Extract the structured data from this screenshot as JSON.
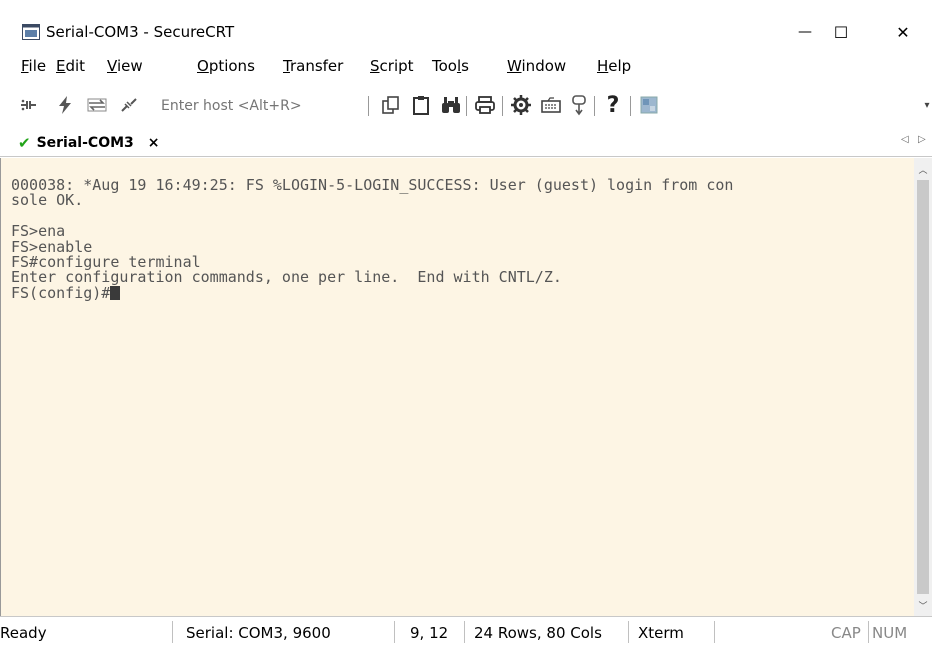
{
  "window": {
    "title": "Serial-COM3 - SecureCRT",
    "minimize_glyph": "—",
    "maximize_glyph": "☐",
    "close_glyph": "✕"
  },
  "menu": [
    {
      "pre": "",
      "u": "F",
      "post": "ile"
    },
    {
      "pre": "",
      "u": "E",
      "post": "dit"
    },
    {
      "pre": "",
      "u": "V",
      "post": "iew"
    },
    {
      "pre": "",
      "u": "O",
      "post": "ptions"
    },
    {
      "pre": "",
      "u": "T",
      "post": "ransfer"
    },
    {
      "pre": "",
      "u": "S",
      "post": "cript"
    },
    {
      "pre": "Too",
      "u": "l",
      "post": "s"
    },
    {
      "pre": "",
      "u": "W",
      "post": "indow"
    },
    {
      "pre": "",
      "u": "H",
      "post": "elp"
    }
  ],
  "toolbar": {
    "host_placeholder": "Enter host <Alt+R>",
    "icons": [
      "connect-icon",
      "quick-connect-icon",
      "reconnect-icon",
      "disconnect-icon",
      "copy-icon",
      "paste-icon",
      "find-icon",
      "print-icon",
      "settings-icon",
      "keymap-icon",
      "sftp-icon",
      "help-icon",
      "screen-icon"
    ]
  },
  "tab": {
    "check_glyph": "✔",
    "label": "Serial-COM3",
    "close_glyph": "×",
    "check_color": "#22a41a"
  },
  "terminal": {
    "lines": [
      "000038: *Aug 19 16:49:25: FS %LOGIN-5-LOGIN_SUCCESS: User (guest) login from con",
      "sole OK.",
      "",
      "FS>ena",
      "FS>enable",
      "FS#configure terminal",
      "Enter configuration commands, one per line.  End with CNTL/Z.",
      "FS(config)#"
    ],
    "background": "#fdf5e4",
    "text_color": "#555555"
  },
  "status": {
    "ready": "Ready",
    "connection": "Serial: COM3, 9600",
    "cursor_pos": "9, 12",
    "size": "24 Rows, 80 Cols",
    "emulation": "Xterm",
    "cap": "CAP",
    "num": "NUM"
  }
}
